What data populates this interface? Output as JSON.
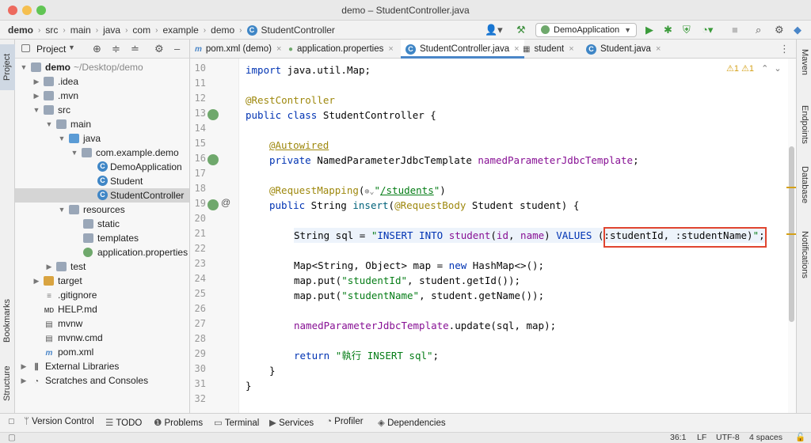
{
  "window": {
    "title": "demo – StudentController.java"
  },
  "navbar": {
    "breadcrumbs": [
      "demo",
      "src",
      "main",
      "java",
      "com",
      "example",
      "demo",
      "StudentController"
    ],
    "run_config": "DemoApplication"
  },
  "left_strip": {
    "tabs": [
      "Project",
      "Bookmarks",
      "Structure"
    ]
  },
  "right_strip": {
    "tabs": [
      "Maven",
      "Endpoints",
      "Database",
      "Notifications"
    ]
  },
  "project": {
    "header_label": "Project",
    "root_name": "demo",
    "root_path": "~/Desktop/demo",
    "items": [
      {
        "label": "demo"
      },
      {
        "label": ".idea"
      },
      {
        "label": ".mvn"
      },
      {
        "label": "src"
      },
      {
        "label": "main"
      },
      {
        "label": "java"
      },
      {
        "label": "com.example.demo"
      },
      {
        "label": "DemoApplication"
      },
      {
        "label": "Student"
      },
      {
        "label": "StudentController"
      },
      {
        "label": "resources"
      },
      {
        "label": "static"
      },
      {
        "label": "templates"
      },
      {
        "label": "application.properties"
      },
      {
        "label": "test"
      },
      {
        "label": "target"
      },
      {
        "label": ".gitignore"
      },
      {
        "label": "HELP.md"
      },
      {
        "label": "mvnw"
      },
      {
        "label": "mvnw.cmd"
      },
      {
        "label": "pom.xml"
      },
      {
        "label": "External Libraries"
      },
      {
        "label": "Scratches and Consoles"
      }
    ]
  },
  "editor_tabs": [
    {
      "label": "pom.xml (demo)"
    },
    {
      "label": "application.properties"
    },
    {
      "label": "StudentController.java"
    },
    {
      "label": "student"
    },
    {
      "label": "Student.java"
    }
  ],
  "editor": {
    "warnings": "⚠1  ⚠1",
    "line_numbers": [
      "10",
      "11",
      "12",
      "13",
      "14",
      "15",
      "16",
      "17",
      "18",
      "19",
      "20",
      "21",
      "22",
      "23",
      "24",
      "25",
      "26",
      "27",
      "28",
      "29",
      "30",
      "31",
      "32"
    ],
    "lines": {
      "l10_import": "import",
      "l10_rest": " java.util.Map;",
      "l12": "@RestController",
      "l13_kw": "public class",
      "l13_rest": " StudentController {",
      "l15": "@Autowired",
      "l16_kw": "private",
      "l16_type": " NamedParameterJdbcTemplate ",
      "l16_field": "namedParameterJdbcTemplate",
      "l16_end": ";",
      "l18_ann": "@RequestMapping",
      "l18_open": "(",
      "l18_q1": "\"",
      "l18_path": "/students",
      "l18_q2": "\"",
      "l18_close": ")",
      "l19_kw": "public",
      "l19_type": " String ",
      "l19_fn": "insert",
      "l19_open": "(",
      "l19_ann": "@RequestBody",
      "l19_rest": " Student student) {",
      "l21_pre": "String sql = ",
      "l21_q": "\"",
      "l21_insert": "INSERT INTO",
      "l21_sp1": " ",
      "l21_table": "student",
      "l21_p1": "(",
      "l21_id": "id",
      "l21_comma": ", ",
      "l21_name": "name",
      "l21_p2": ") ",
      "l21_values": "VALUES",
      "l21_params": " (:studentId, :studentName)",
      "l21_q2": "\"",
      "l21_end": ";",
      "l23_pre": "Map<String, Object> map = ",
      "l23_new": "new",
      "l23_rest": " HashMap<>();",
      "l24_pre": "map.put(",
      "l24_str": "\"studentId\"",
      "l24_rest": ", student.getId());",
      "l25_pre": "map.put(",
      "l25_str": "\"studentName\"",
      "l25_rest": ", student.getName());",
      "l27_field": "namedParameterJdbcTemplate",
      "l27_rest": ".update(sql, map);",
      "l29_kw": "return",
      "l29_sp": " ",
      "l29_str": "\"執行 INSERT sql\"",
      "l29_end": ";",
      "l30": "}",
      "l31": "}"
    }
  },
  "bottom_tabs": [
    "Version Control",
    "TODO",
    "Problems",
    "Terminal",
    "Services",
    "Profiler",
    "Dependencies"
  ],
  "status": {
    "position": "36:1",
    "line_sep": "LF",
    "encoding": "UTF-8",
    "indent": "4 spaces"
  }
}
